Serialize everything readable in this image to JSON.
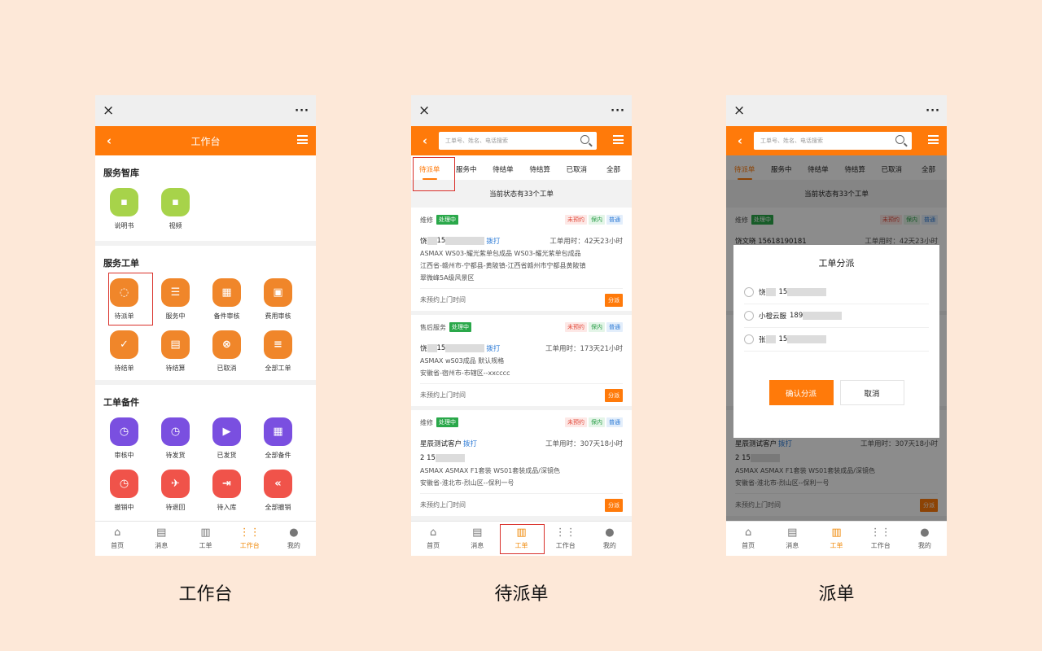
{
  "wx_bar": {
    "close": "×",
    "more": "···"
  },
  "phone1": {
    "title": "工作台",
    "sections": [
      {
        "title": "服务智库",
        "items": [
          {
            "label": "说明书",
            "color": "#a7d34a",
            "glyph": "▪"
          },
          {
            "label": "视频",
            "color": "#a7d34a",
            "glyph": "▪"
          }
        ]
      },
      {
        "title": "服务工单",
        "items": [
          {
            "label": "待派单",
            "color": "#f0862a",
            "glyph": "◌"
          },
          {
            "label": "服务中",
            "color": "#f0862a",
            "glyph": "☰"
          },
          {
            "label": "备件审核",
            "color": "#f0862a",
            "glyph": "▦"
          },
          {
            "label": "费用审核",
            "color": "#f0862a",
            "glyph": "▣"
          },
          {
            "label": "待结单",
            "color": "#f0862a",
            "glyph": "✓"
          },
          {
            "label": "待结算",
            "color": "#f0862a",
            "glyph": "▤"
          },
          {
            "label": "已取消",
            "color": "#f0862a",
            "glyph": "⊗"
          },
          {
            "label": "全部工单",
            "color": "#f0862a",
            "glyph": "≡"
          }
        ]
      },
      {
        "title": "工单备件",
        "items": [
          {
            "label": "审核中",
            "color": "#7a4fe0",
            "glyph": "◷"
          },
          {
            "label": "待发货",
            "color": "#7a4fe0",
            "glyph": "◷"
          },
          {
            "label": "已发货",
            "color": "#7a4fe0",
            "glyph": "▶"
          },
          {
            "label": "全部备件",
            "color": "#7a4fe0",
            "glyph": "▦"
          },
          {
            "label": "撤销中",
            "color": "#f0534a",
            "glyph": "◷"
          },
          {
            "label": "待退回",
            "color": "#f0534a",
            "glyph": "✈"
          },
          {
            "label": "待入库",
            "color": "#f0534a",
            "glyph": "⇥"
          },
          {
            "label": "全部撤销",
            "color": "#f0534a",
            "glyph": "«"
          }
        ]
      }
    ]
  },
  "tabbar": [
    {
      "label": "首页",
      "icon": "⌂",
      "name": "home"
    },
    {
      "label": "消息",
      "icon": "▤",
      "name": "message"
    },
    {
      "label": "工单",
      "icon": "▥",
      "name": "workorder"
    },
    {
      "label": "工作台",
      "icon": "⋮⋮",
      "name": "workbench"
    },
    {
      "label": "我的",
      "icon": "●",
      "name": "mine"
    }
  ],
  "search": {
    "placeholder": "工单号、姓名、电话搜索"
  },
  "status_tabs": [
    "待派单",
    "服务中",
    "待结单",
    "待结算",
    "已取消",
    "全部"
  ],
  "count_text": "当前状态有33个工单",
  "card_tags": [
    "未预约",
    "保内",
    "普通"
  ],
  "status_badge": "处理中",
  "call_text": "拨打",
  "dispatch_text": "分派",
  "visit_text": "未预约上门时间",
  "cards": [
    {
      "type": "维修",
      "name": "饶",
      "phone": "15",
      "time": "工单用时：42天23小时",
      "details": [
        "ASMAX WS03-耀光紫单包成品 WS03-耀光紫单包成品",
        "江西省-赣州市-宁都县-黄陂镇-江西省赣州市宁都县黄陂镇",
        "翠微峰5A级风景区"
      ]
    },
    {
      "type": "售后服务",
      "name": "饶",
      "phone": "15",
      "time": "工单用时：173天21小时",
      "details": [
        "ASMAX wS03成品 默认规格",
        "安徽省-宿州市-市辖区--xxcccc"
      ]
    },
    {
      "type": "维修",
      "name": "星辰测试客户",
      "phone": "2 15",
      "time": "工单用时：307天18小时",
      "details": [
        "ASMAX ASMAX F1套装 WS01套装成品/深镜色",
        "安徽省-淮北市-烈山区--保利一号"
      ]
    }
  ],
  "phone3_peek": {
    "name": "饶文晓 15618190181",
    "bottom_name": "星辰测试客户",
    "bottom_phone": "2 15618191111"
  },
  "dialog": {
    "title": "工单分派",
    "options": [
      {
        "name": "饶",
        "phone": "15"
      },
      {
        "name": "小橙云服",
        "phone": "189"
      },
      {
        "name": "张",
        "phone": "15"
      }
    ],
    "confirm": "确认分派",
    "cancel": "取消"
  },
  "captions": [
    "工作台",
    "待派单",
    "派单"
  ]
}
